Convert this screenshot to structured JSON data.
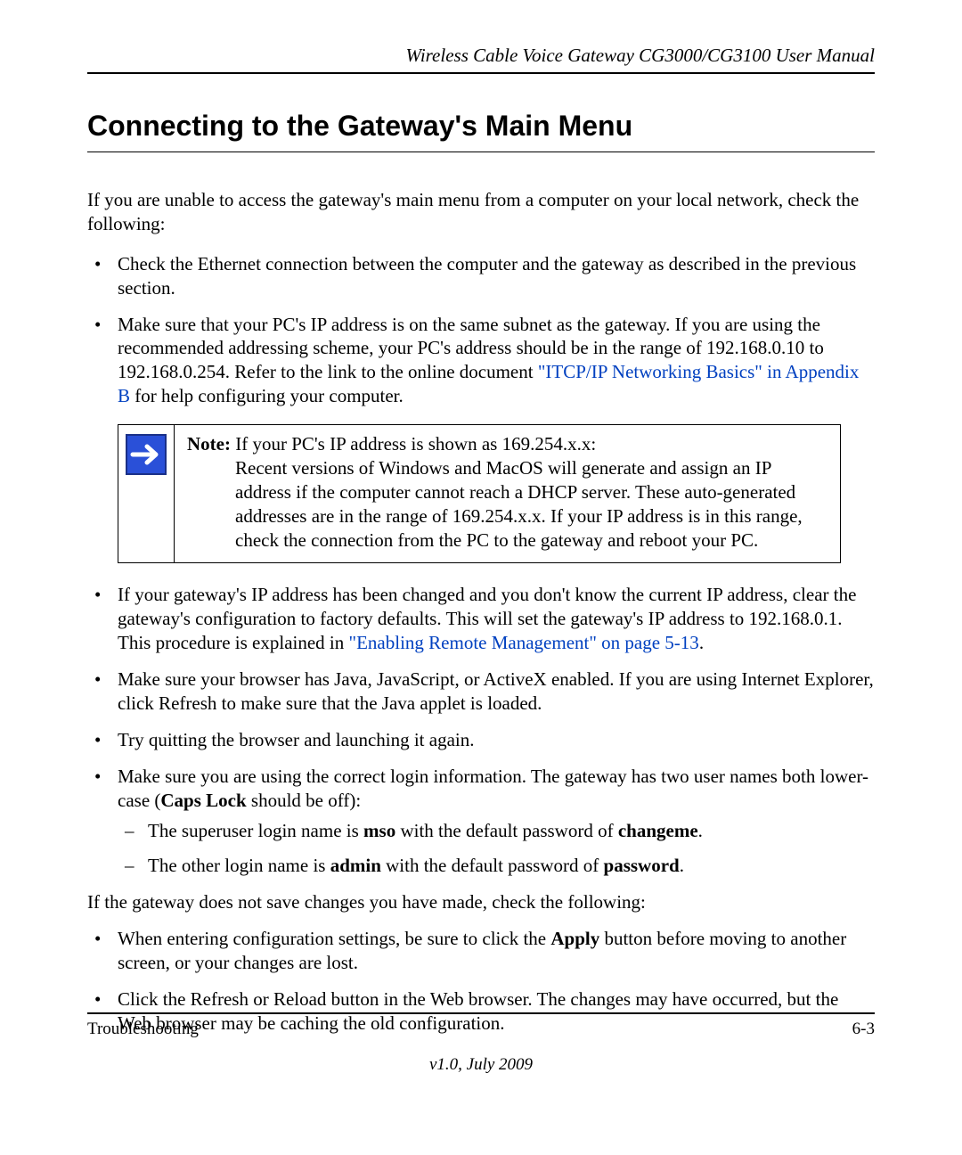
{
  "header": {
    "running_title": "Wireless Cable Voice Gateway CG3000/CG3100 User Manual"
  },
  "section": {
    "title": "Connecting to the Gateway's Main Menu"
  },
  "intro": "If you are unable to access the gateway's main menu from a computer on your local network, check the following:",
  "bullets1": {
    "b0": "Check the Ethernet connection between the computer and the gateway as described in the previous section.",
    "b1_pre": "Make sure that your PC's IP address is on the same subnet as the gateway. If you are using the recommended addressing scheme, your PC's address should be in the range of 192.168.0.10 to 192.168.0.254. Refer to the link to the online document ",
    "b1_link": "\"ITCP/IP Networking Basics\" in Appendix B",
    "b1_post": " for help configuring your computer."
  },
  "note": {
    "label": "Note:",
    "line1": " If your PC's IP address is shown as 169.254.x.x:",
    "body": "Recent versions of Windows and MacOS will generate and assign an IP address if the computer cannot reach a DHCP server. These auto-generated addresses are in the range of 169.254.x.x. If your IP address is in this range, check the connection from the PC to the gateway and reboot your PC."
  },
  "bullets2": {
    "b0_pre": "If your gateway's IP address has been changed and you don't know the current IP address, clear the gateway's configuration to factory defaults. This will set the gateway's IP address to 192.168.0.1. This procedure is explained in ",
    "b0_link": "\"Enabling Remote Management\" on page 5-13",
    "b0_post": ".",
    "b1": "Make sure your browser has Java, JavaScript, or ActiveX enabled. If you are using Internet Explorer, click Refresh to make sure that the Java applet is loaded.",
    "b2": "Try quitting the browser and launching it again.",
    "b3_pre": "Make sure you are using the correct login information. The gateway has two user names both lower-case (",
    "b3_bold": "Caps Lock",
    "b3_post": " should be off):",
    "sub1_pre": "The superuser login name is ",
    "sub1_b1": "mso",
    "sub1_mid": " with the default password of ",
    "sub1_b2": "changeme",
    "sub1_post": ".",
    "sub2_pre": "The other login name is ",
    "sub2_b1": "admin",
    "sub2_mid": " with the default password of ",
    "sub2_b2": "password",
    "sub2_post": "."
  },
  "para2": "If the gateway does not save changes you have made, check the following:",
  "bullets3": {
    "b0_pre": "When entering configuration settings, be sure to click the ",
    "b0_bold": "Apply",
    "b0_post": " button before moving to another screen, or your changes are lost.",
    "b1": "Click the Refresh or Reload button in the Web browser. The changes may have occurred, but the Web browser may be caching the old configuration."
  },
  "footer": {
    "left": "Troubleshooting",
    "right": "6-3",
    "version": "v1.0, July 2009"
  }
}
